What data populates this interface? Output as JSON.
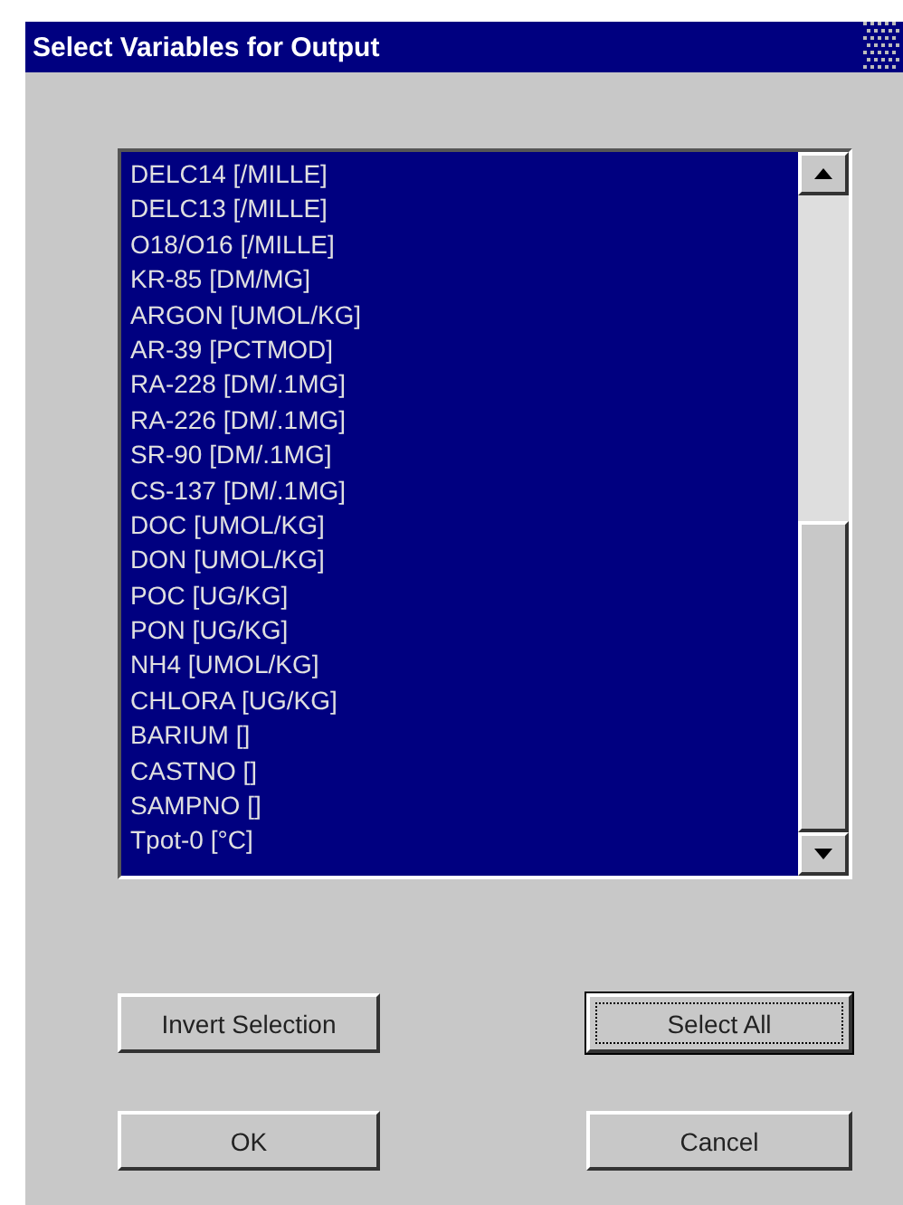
{
  "window": {
    "title": "Select Variables for Output"
  },
  "list": {
    "items": [
      {
        "label": "DELC14 [/MILLE]",
        "selected": true
      },
      {
        "label": "DELC13 [/MILLE]",
        "selected": true
      },
      {
        "label": "O18/O16 [/MILLE]",
        "selected": true
      },
      {
        "label": "KR-85 [DM/MG]",
        "selected": true
      },
      {
        "label": "ARGON [UMOL/KG]",
        "selected": true
      },
      {
        "label": "AR-39 [PCTMOD]",
        "selected": true
      },
      {
        "label": "RA-228 [DM/.1MG]",
        "selected": true
      },
      {
        "label": "RA-226 [DM/.1MG]",
        "selected": true
      },
      {
        "label": "SR-90 [DM/.1MG]",
        "selected": true
      },
      {
        "label": "CS-137 [DM/.1MG]",
        "selected": true
      },
      {
        "label": "DOC [UMOL/KG]",
        "selected": true
      },
      {
        "label": "DON [UMOL/KG]",
        "selected": true
      },
      {
        "label": "POC [UG/KG]",
        "selected": true
      },
      {
        "label": "PON [UG/KG]",
        "selected": true
      },
      {
        "label": "NH4 [UMOL/KG]",
        "selected": true
      },
      {
        "label": "CHLORA [UG/KG]",
        "selected": true
      },
      {
        "label": "BARIUM []",
        "selected": true
      },
      {
        "label": "CASTNO []",
        "selected": true
      },
      {
        "label": "SAMPNO []",
        "selected": true
      },
      {
        "label": "Tpot-0 [°C]",
        "selected": true
      }
    ]
  },
  "buttons": [
    {
      "label": "Invert Selection",
      "focused": false
    },
    {
      "label": "Select All",
      "focused": true
    },
    {
      "label": "OK",
      "focused": false
    },
    {
      "label": "Cancel",
      "focused": false
    }
  ]
}
